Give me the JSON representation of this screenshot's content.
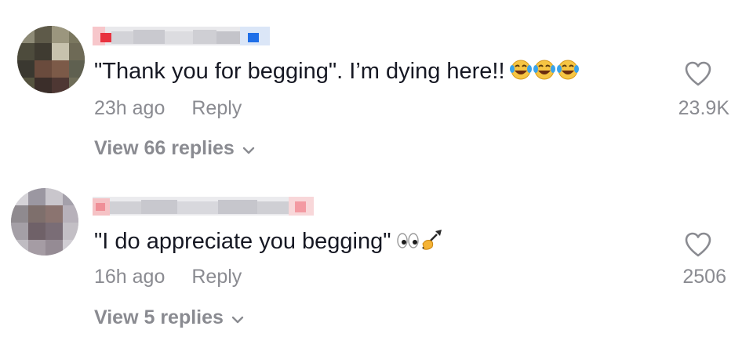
{
  "comments": [
    {
      "text": "\"Thank you for begging\". I’m dying here!!",
      "time": "23h ago",
      "reply_label": "Reply",
      "likes": "23.9K",
      "view_replies": "View 66 replies",
      "emoji": "laughing-crying-face x3"
    },
    {
      "text": "\"I do appreciate you begging\"",
      "time": "16h ago",
      "reply_label": "Reply",
      "likes": "2506",
      "view_replies": "View 5 replies",
      "emoji": "eyes + writing-hand"
    }
  ],
  "colors": {
    "text": "#161823",
    "muted": "#8a8b91",
    "background": "#ffffff"
  }
}
